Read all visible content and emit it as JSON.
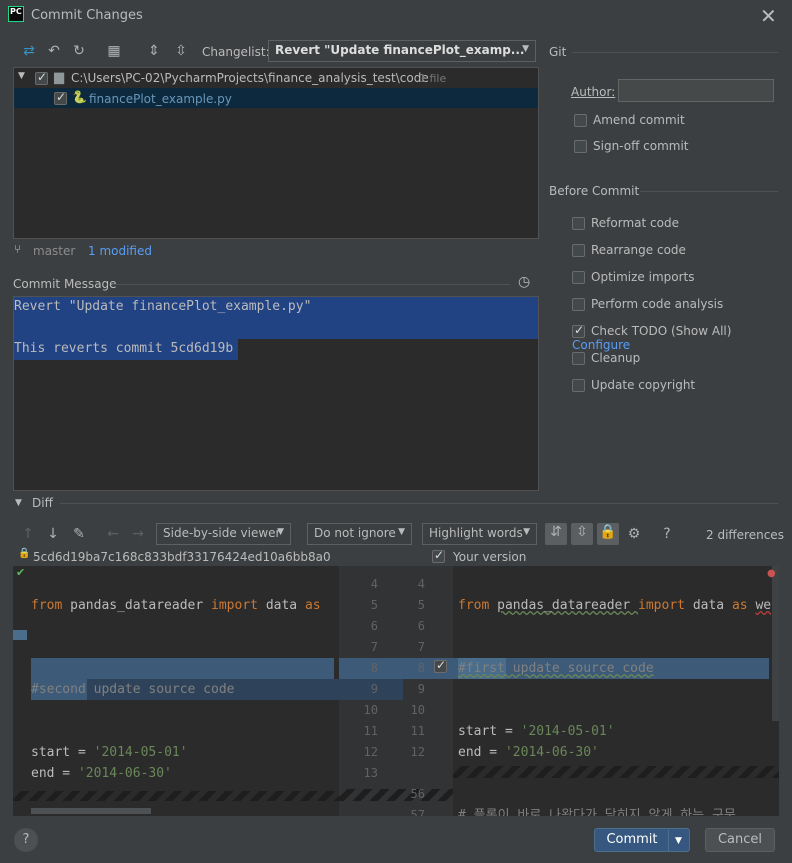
{
  "window": {
    "title": "Commit Changes",
    "app_icon": "PC"
  },
  "toolbar": {
    "changelist_label": "Changelist:",
    "changelist_value": "Revert \"Update financePlot_examp..."
  },
  "changes": {
    "root_path": "C:\\Users\\PC-02\\PycharmProjects\\finance_analysis_test\\code",
    "root_count": "1 file",
    "file_name": "financePlot_example.py"
  },
  "branch": {
    "name": "master",
    "status": "1 modified"
  },
  "commit_message": {
    "label": "Commit Message",
    "line1": "Revert \"Update financePlot_example.py\"",
    "line2": "",
    "line3": "This reverts commit 5cd6d19b"
  },
  "git": {
    "section": "Git",
    "author_label": "Author:",
    "author_value": "",
    "amend": "Amend commit",
    "signoff": "Sign-off commit"
  },
  "before_commit": {
    "section": "Before Commit",
    "reformat": "Reformat code",
    "rearrange": "Rearrange code",
    "optimize": "Optimize imports",
    "analysis": "Perform code analysis",
    "todo": "Check TODO (Show All)",
    "todo_link": "Configure",
    "cleanup": "Cleanup",
    "copyright": "Update copyright"
  },
  "diff": {
    "label": "Diff",
    "viewer": "Side-by-side viewer",
    "ignore": "Do not ignore",
    "highlight": "Highlight words",
    "differences": "2 differences",
    "left_revision": "5cd6d19ba7c168c833bdf33176424ed10a6bb8a0",
    "right_revision": "Your version",
    "left_lines": {
      "l5a": "from ",
      "l5b": "pandas_datareader ",
      "l5c": "import ",
      "l5d": "data ",
      "l5e": "as",
      "l9": "#second update source code",
      "l12a": "start = ",
      "l12b": "'2014-05-01'",
      "l13a": "end = ",
      "l13b": "'2014-06-30'"
    },
    "right_lines": {
      "r5a": "from ",
      "r5b": "pandas_datareader ",
      "r5c": "import ",
      "r5d": "data ",
      "r5e": "as ",
      "r5f": "we",
      "r8": "#first update source code",
      "r11a": "start = ",
      "r11b": "'2014-05-01'",
      "r12a": "end = ",
      "r12b": "'2014-06-30'",
      "r56": "# 플롯이 바로 나왔다가 닫히지 않게 하는 구문"
    },
    "left_numbers": [
      "4",
      "5",
      "6",
      "7",
      "8",
      "9",
      "10",
      "11",
      "12",
      "13"
    ],
    "right_numbers": [
      "4",
      "5",
      "6",
      "7",
      "8",
      "9",
      "10",
      "11",
      "12",
      "56",
      "57"
    ]
  },
  "footer": {
    "commit": "Commit",
    "cancel": "Cancel",
    "help": "?"
  },
  "colors": {
    "accent": "#365880",
    "selection": "#214283",
    "link": "#589df6"
  }
}
